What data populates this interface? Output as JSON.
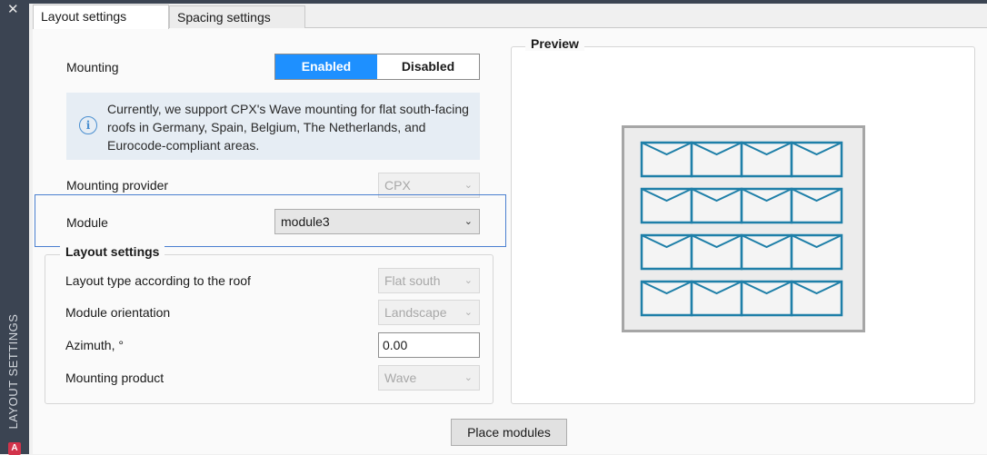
{
  "sidebar": {
    "close_icon": "close-icon",
    "title": "LAYOUT SETTINGS",
    "badge": "A",
    "badge_color": "#d2334b"
  },
  "tabs": [
    {
      "label": "Layout settings",
      "active": true
    },
    {
      "label": "Spacing settings",
      "active": false
    }
  ],
  "mounting": {
    "label": "Mounting",
    "options": [
      "Enabled",
      "Disabled"
    ],
    "selected": "Enabled",
    "accent": "#1e90ff"
  },
  "info": {
    "icon": "info-icon",
    "text": "Currently, we support CPX's Wave mounting for flat south-facing roofs in Germany, Spain, Belgium, The Netherlands, and Eurocode-compliant areas."
  },
  "mounting_provider": {
    "label": "Mounting provider",
    "value": "CPX"
  },
  "module": {
    "label": "Module",
    "value": "module3"
  },
  "layout_group": {
    "title": "Layout settings",
    "layout_type": {
      "label": "Layout type according to the roof",
      "value": "Flat south"
    },
    "module_orientation": {
      "label": "Module orientation",
      "value": "Landscape"
    },
    "azimuth": {
      "label": "Azimuth, °",
      "value": "0.00"
    },
    "mounting_product": {
      "label": "Mounting product",
      "value": "Wave"
    }
  },
  "preview": {
    "title": "Preview",
    "rows": 4,
    "columns": 4,
    "module_color": "#1e7fa8"
  },
  "place_button": "Place modules"
}
